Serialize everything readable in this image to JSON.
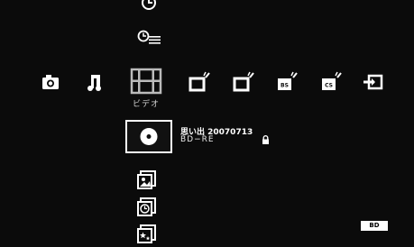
{
  "xmb": {
    "categories": [
      {
        "id": "photo",
        "icon": "camera-icon"
      },
      {
        "id": "music",
        "icon": "music-note-icon"
      },
      {
        "id": "video",
        "icon": "film-strip-icon",
        "label": "ビデオ",
        "selected": true
      },
      {
        "id": "tv1",
        "icon": "tv-icon"
      },
      {
        "id": "tv2",
        "icon": "tv-icon"
      },
      {
        "id": "tv-bs",
        "icon": "tv-bs-icon",
        "badge": "BS"
      },
      {
        "id": "tv-cs",
        "icon": "tv-cs-icon",
        "badge": "CS"
      },
      {
        "id": "input",
        "icon": "input-icon"
      }
    ],
    "category_label": "ビデオ"
  },
  "video_menu": {
    "top_icons": [
      "timer-icon",
      "timer-list-icon"
    ],
    "selected_item": {
      "icon": "disc-icon",
      "title": "思い出 20070713",
      "subtitle": "BD−RE",
      "protected": true
    },
    "below_icons": [
      "photo-album-icon",
      "clock-album-icon",
      "star-album-icon"
    ]
  },
  "status": {
    "media_badge": "BD"
  },
  "colors": {
    "background": "#0b0b0b",
    "foreground": "#ffffff"
  }
}
